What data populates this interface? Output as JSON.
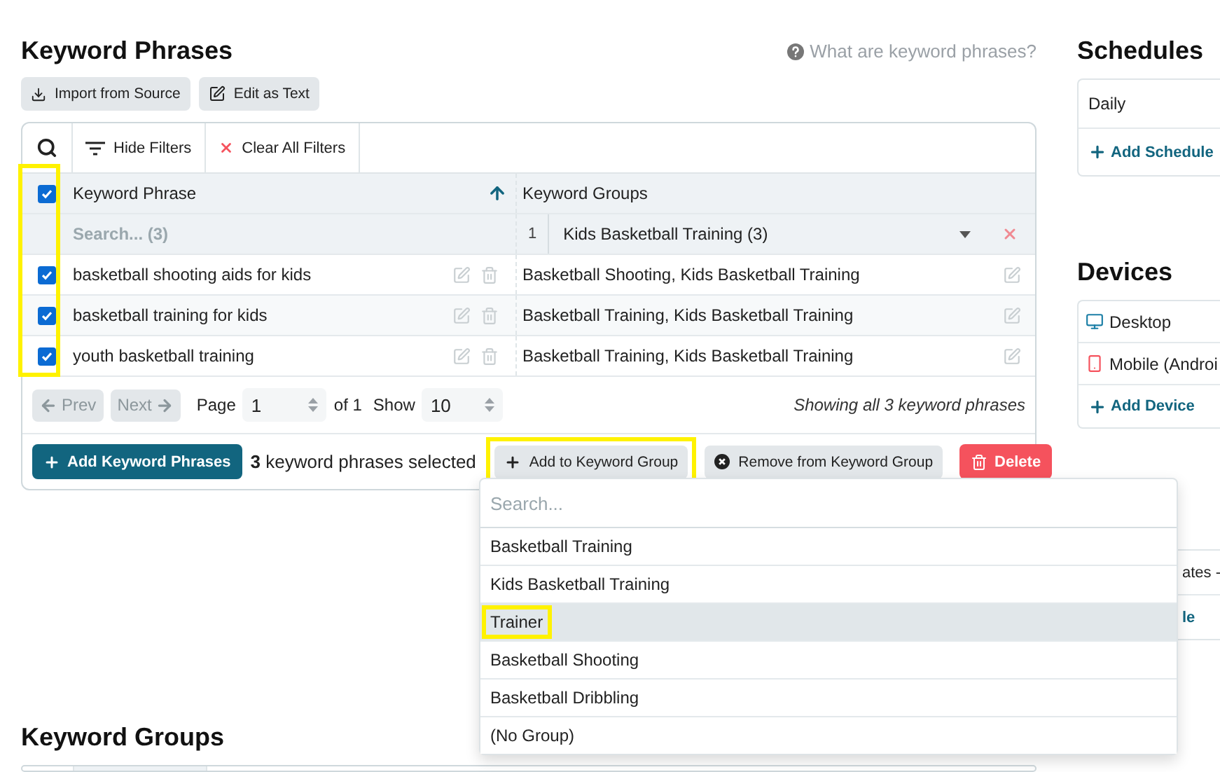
{
  "header": {
    "title": "Keyword Phrases",
    "help_link": "What are keyword phrases?"
  },
  "toolbar_buttons": [
    {
      "kind": "import",
      "label": "Import from Source"
    },
    {
      "kind": "edit",
      "label": "Edit as Text"
    }
  ],
  "table": {
    "filter_bar": {
      "hide_filters": "Hide Filters",
      "clear_all": "Clear All Filters"
    },
    "select_all_checked": true,
    "checkbox_column_highlighted": true,
    "columns": [
      {
        "label": "Keyword Phrase",
        "sorted": true
      },
      {
        "label": "Keyword Groups",
        "sorted": false
      }
    ],
    "filters": {
      "phrase_placeholder": "Search... (3)",
      "group_count": "1",
      "group_value": "Kids Basketball Training (3)"
    },
    "rows": [
      {
        "checked": true,
        "phrase": "basketball shooting aids for kids",
        "groups": "Basketball Shooting, Kids Basketball Training"
      },
      {
        "checked": true,
        "phrase": "basketball training for kids",
        "groups": "Basketball Training, Kids Basketball Training"
      },
      {
        "checked": true,
        "phrase": "youth basketball training",
        "groups": "Basketball Training, Kids Basketball Training"
      }
    ],
    "pagination": {
      "prev": "Prev",
      "next": "Next",
      "page_label": "Page",
      "page": "1",
      "of": "of 1",
      "show_label": "Show",
      "show": "10",
      "summary": "Showing all 3 keyword phrases"
    },
    "actions": {
      "add": "Add Keyword Phrases",
      "selection": "**3** keyword phrases selected",
      "buttons": [
        {
          "kind": "add",
          "label": "Add to Keyword Group",
          "highlighted": true
        },
        {
          "kind": "remove",
          "label": "Remove from Keyword Group",
          "highlighted": false
        },
        {
          "kind": "delete",
          "label": "Delete",
          "highlighted": false
        }
      ]
    }
  },
  "dropdown": {
    "placeholder": "Search...",
    "options": [
      {
        "label": "Basketball Training",
        "selected": false,
        "highlighted": false
      },
      {
        "label": "Kids Basketball Training",
        "selected": false,
        "highlighted": false
      },
      {
        "label": "Trainer",
        "selected": true,
        "highlighted": true
      },
      {
        "label": "Basketball Shooting",
        "selected": false,
        "highlighted": false
      },
      {
        "label": "Basketball Dribbling",
        "selected": false,
        "highlighted": false
      },
      {
        "label": "(No Group)",
        "selected": false,
        "highlighted": false
      }
    ]
  },
  "keyword_groups": {
    "title": "Keyword Groups"
  },
  "sidebar": {
    "schedules": {
      "title": "Schedules",
      "items": [
        "Daily"
      ],
      "add": "Add Schedule"
    },
    "devices": {
      "title": "Devices",
      "items": [
        {
          "kind": "desktop",
          "label": "Desktop"
        },
        {
          "kind": "mobile",
          "label": "Mobile (Androi"
        }
      ],
      "add": "Add Device"
    },
    "partial_card": {
      "lines": [
        "ates -",
        "le"
      ]
    }
  }
}
